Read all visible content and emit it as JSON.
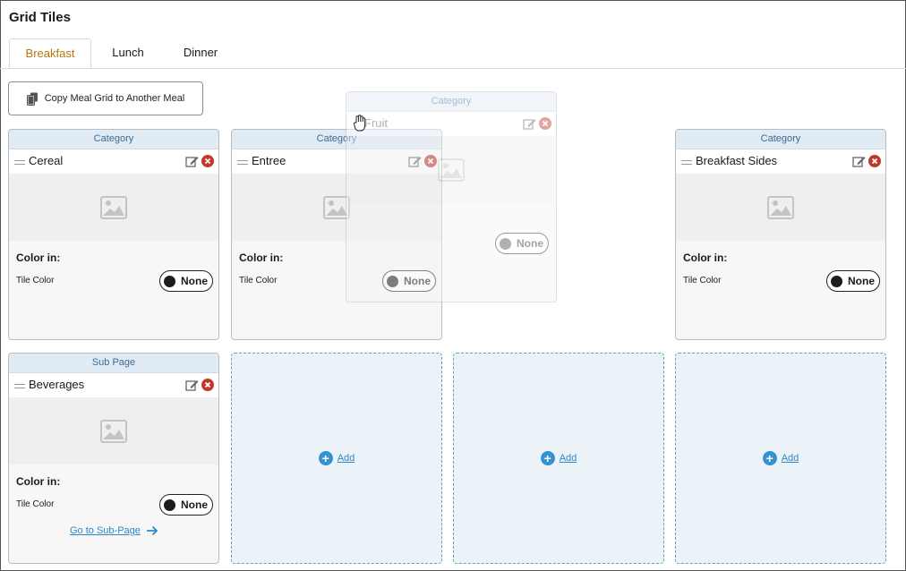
{
  "page": {
    "title": "Grid Tiles"
  },
  "tabs": [
    {
      "label": "Breakfast",
      "active": true
    },
    {
      "label": "Lunch",
      "active": false
    },
    {
      "label": "Dinner",
      "active": false
    }
  ],
  "toolbar": {
    "copy_label": "Copy Meal Grid to Another Meal",
    "copy_icon": "copy-icon"
  },
  "tiles": [
    {
      "type": "Category",
      "name": "Cereal",
      "color_label": "Color in:",
      "tile_color_label": "Tile Color",
      "color_value": "None"
    },
    {
      "type": "Category",
      "name": "Entree",
      "color_label": "Color in:",
      "tile_color_label": "Tile Color",
      "color_value": "None"
    },
    {
      "type": "Category",
      "name": "Breakfast Sides",
      "color_label": "Color in:",
      "tile_color_label": "Tile Color",
      "color_value": "None"
    },
    {
      "type": "Sub Page",
      "name": "Beverages",
      "color_label": "Color in:",
      "tile_color_label": "Tile Color",
      "color_value": "None",
      "link_label": "Go to Sub-Page"
    }
  ],
  "dragging_tile": {
    "type": "Category",
    "name": "Fruit",
    "color_value": "None"
  },
  "add_slots": [
    {
      "label": "Add"
    },
    {
      "label": "Add"
    },
    {
      "label": "Add"
    }
  ],
  "colors": {
    "accent": "#b8760c",
    "header_bg": "#e1ebf5",
    "link": "#2f87c6",
    "delete": "#c0392b",
    "add_bg": "#ebf3f8"
  }
}
